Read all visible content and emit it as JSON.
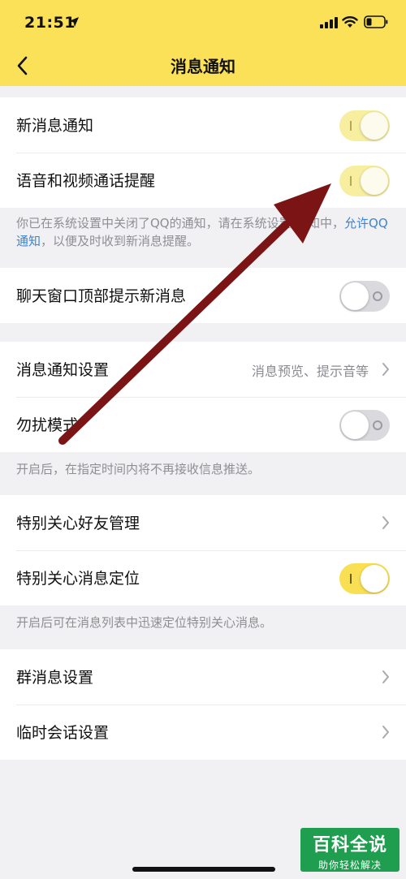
{
  "status_bar": {
    "time": "21:51",
    "icons": [
      "location-arrow-icon",
      "signal-icon",
      "wifi-icon",
      "battery-icon"
    ]
  },
  "nav": {
    "title": "消息通知",
    "back_icon": "chevron-left-icon"
  },
  "groups": [
    {
      "rows": [
        {
          "label": "新消息通知",
          "control": "toggle",
          "state": "on-faded"
        },
        {
          "label": "语音和视频通话提醒",
          "control": "toggle",
          "state": "on-faded"
        }
      ],
      "note": {
        "text_before": "你已在系统设置中关闭了QQ的通知，请在系统设置-通知中，",
        "link": "允许QQ通知",
        "text_after": "，以便及时收到新消息提醒。"
      }
    },
    {
      "rows": [
        {
          "label": "聊天窗口顶部提示新消息",
          "control": "toggle",
          "state": "off"
        }
      ]
    },
    {
      "rows": [
        {
          "label": "消息通知设置",
          "control": "chevron",
          "value": "消息预览、提示音等"
        },
        {
          "label": "勿扰模式",
          "control": "toggle",
          "state": "off"
        }
      ],
      "note": {
        "text": "开启后，在指定时间内将不再接收信息推送。"
      }
    },
    {
      "rows": [
        {
          "label": "特别关心好友管理",
          "control": "chevron"
        },
        {
          "label": "特别关心消息定位",
          "control": "toggle",
          "state": "on"
        }
      ],
      "note": {
        "text": "开启后可在消息列表中迅速定位特别关心消息。"
      }
    },
    {
      "rows": [
        {
          "label": "群消息设置",
          "control": "chevron"
        },
        {
          "label": "临时会话设置",
          "control": "chevron"
        }
      ]
    }
  ],
  "watermark": {
    "title": "百科全说",
    "subtitle": "助你轻松解决"
  },
  "colors": {
    "header_yellow": "#fbe157",
    "toggle_on": "#f9df54",
    "toggle_faded": "#f8ee9f",
    "toggle_off": "#d9d9de",
    "link_blue": "#3b84d6",
    "arrow_red": "#7b1414",
    "watermark_green": "#1e9e4e"
  }
}
